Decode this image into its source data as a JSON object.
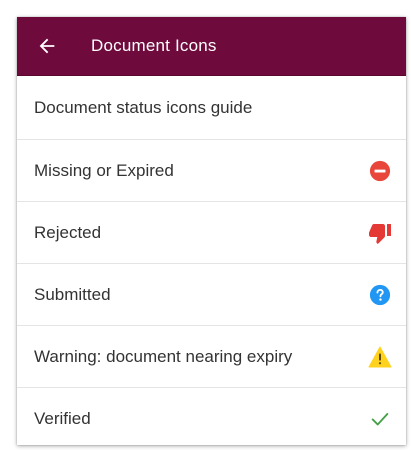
{
  "appbar": {
    "title": "Document Icons",
    "back_icon": "arrow-left-icon"
  },
  "guide": {
    "title": "Document status icons guide"
  },
  "statuses": [
    {
      "label": "Missing or Expired",
      "icon": "minus-circle-icon",
      "color": "#e8463a"
    },
    {
      "label": "Rejected",
      "icon": "thumbs-down-icon",
      "color": "#e53935"
    },
    {
      "label": "Submitted",
      "icon": "question-circle-icon",
      "color": "#2196f3"
    },
    {
      "label": "Warning: document nearing expiry",
      "icon": "warning-triangle-icon",
      "color": "#ffd21f"
    },
    {
      "label": "Verified",
      "icon": "checkmark-icon",
      "color": "#43a047"
    }
  ],
  "colors": {
    "appbar_background": "#6e0a3c",
    "appbar_text": "#ffffff"
  }
}
